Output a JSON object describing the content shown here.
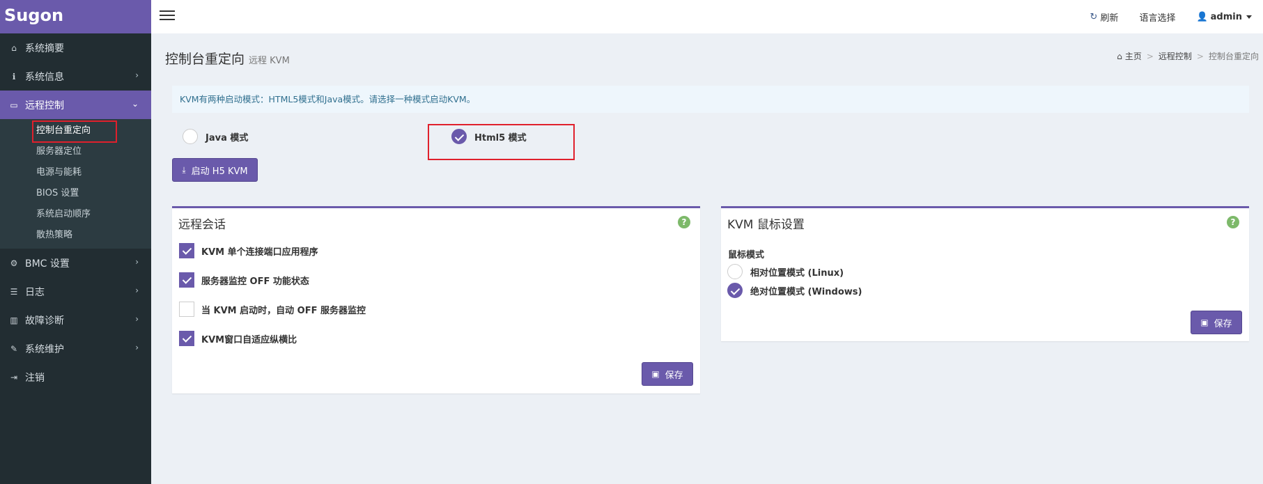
{
  "app": {
    "logo": "Sugon"
  },
  "sidebar": {
    "items": [
      {
        "label": "系统摘要",
        "icon": "home-icon"
      },
      {
        "label": "系统信息",
        "icon": "info-icon"
      },
      {
        "label": "远程控制",
        "icon": "monitor-icon"
      },
      {
        "label": "BMC 设置",
        "icon": "gear-icon"
      },
      {
        "label": "日志",
        "icon": "database-icon"
      },
      {
        "label": "故障诊断",
        "icon": "bar-chart-icon"
      },
      {
        "label": "系统维护",
        "icon": "wrench-icon"
      },
      {
        "label": "注销",
        "icon": "logout-icon"
      }
    ],
    "submenu": [
      "控制台重定向",
      "服务器定位",
      "电源与能耗",
      "BIOS 设置",
      "系统启动顺序",
      "散热策略"
    ]
  },
  "header": {
    "refresh": "刷新",
    "language": "语言选择",
    "user": "admin"
  },
  "page": {
    "title": "控制台重定向",
    "subtitle": "远程 KVM"
  },
  "breadcrumb": [
    "主页",
    "远程控制",
    "控制台重定向"
  ],
  "info": "KVM有两种启动模式：HTML5模式和Java模式。请选择一种模式启动KVM。",
  "modes": {
    "java": "Java 模式",
    "html5": "Html5 模式",
    "selected": "html5"
  },
  "launch_button": "启动 H5 KVM",
  "remote_session": {
    "title": "远程会话",
    "options": [
      {
        "label": "KVM 单个连接端口应用程序",
        "checked": true
      },
      {
        "label": "服务器监控 OFF 功能状态",
        "checked": true
      },
      {
        "label": "当 KVM 启动时，自动 OFF 服务器监控",
        "checked": false
      },
      {
        "label": "KVM窗口自适应纵横比",
        "checked": true
      }
    ],
    "save": "保存"
  },
  "mouse": {
    "title": "KVM 鼠标设置",
    "mode_label": "鼠标模式",
    "options": [
      {
        "label": "相对位置模式 (Linux)",
        "selected": false
      },
      {
        "label": "绝对位置模式 (Windows)",
        "selected": true
      }
    ],
    "save": "保存"
  },
  "colors": {
    "accent": "#6a5aab",
    "sidebar": "#222d32",
    "highlight": "#e0202c"
  }
}
